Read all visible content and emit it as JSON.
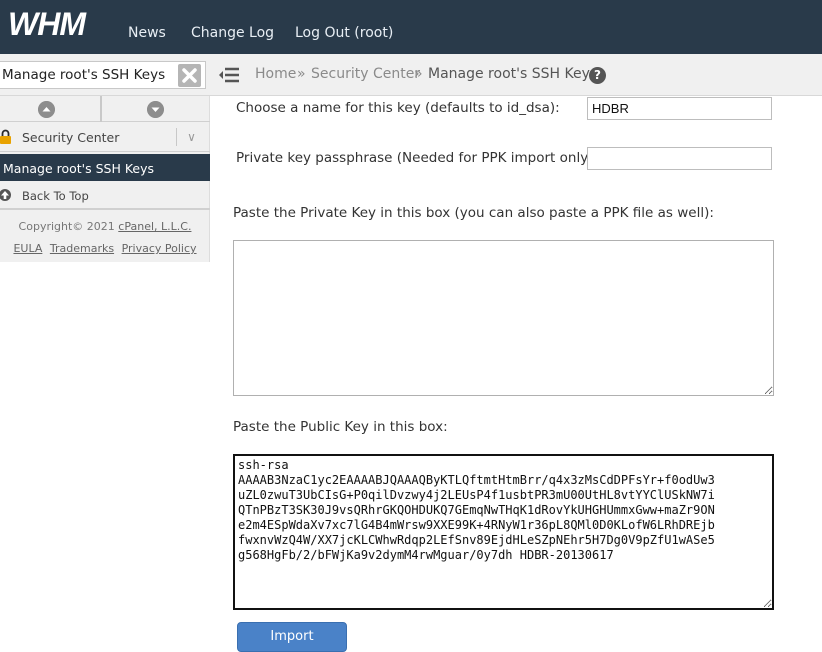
{
  "header": {
    "logo_text": "WHM",
    "nav": [
      "News",
      "Change Log",
      "Log Out (root)"
    ]
  },
  "search": {
    "value": "Manage root's SSH Keys"
  },
  "breadcrumb": {
    "items": [
      "Home",
      "Security Center",
      "Manage root's SSH Keys"
    ],
    "separator": "»"
  },
  "sidebar": {
    "section": "Security Center",
    "active_item": "Manage root's SSH Keys",
    "back_to_top": "Back To Top",
    "copyright_prefix": "Copyright© 2021",
    "copyright_link": "cPanel, L.L.C.",
    "footer_links": [
      "EULA",
      "Trademarks",
      "Privacy Policy"
    ]
  },
  "form": {
    "key_name_label": "Choose a name for this key (defaults to id_dsa):",
    "key_name_value": "HDBR",
    "passphrase_label": "Private key passphrase (Needed for PPK import only):",
    "passphrase_value": "",
    "private_key_label": "Paste the Private Key in this box (you can also paste a PPK file as well):",
    "private_key_value": "",
    "public_key_label": "Paste the Public Key in this box:",
    "public_key_value": "ssh-rsa\nAAAAB3NzaC1yc2EAAAABJQAAAQByKTLQftmtHtmBrr/q4x3zMsCdDPFsYr+f0odUw3\nuZL0zwuT3UbCIsG+P0qilDvzwy4j2LEUsP4f1usbtPR3mU00UtHL8vtYYClUSkNW7i\nQTnPBzT3SK30J9vsQRhrGKQOHDUKQ7GEmqNwTHqK1dRovYkUHGHUmmxGww+maZr9ON\ne2m4ESpWdaXv7xc7lG4B4mWrsw9XXE99K+4RNyW1r36pL8QMl0D0KLofW6LRhDREjb\nfwxnvWzQ4W/XX7jcKLCWhwRdqp2LEfSnv89EjdHLeSZpNEhr5H7Dg0V9pZfU1wASe5\ng568HgFb/2/bFWjKa9v2dymM4rwMguar/0y7dh HDBR-20130617",
    "import_button": "Import"
  },
  "colors": {
    "header_bg": "#293a4a",
    "button_bg": "#4a82c8"
  }
}
